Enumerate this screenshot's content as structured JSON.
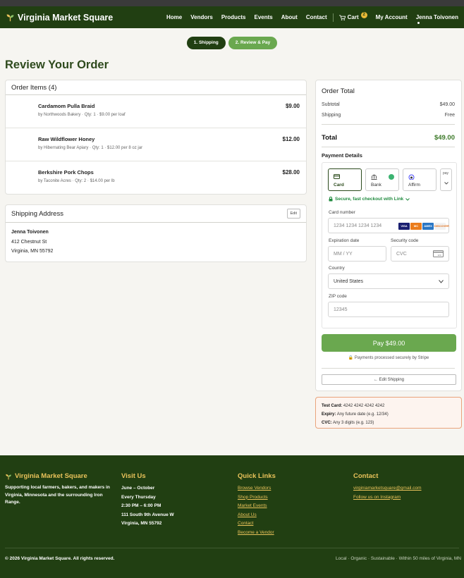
{
  "header": {
    "brand": "Virginia Market Square",
    "nav": [
      "Home",
      "Vendors",
      "Products",
      "Events",
      "About",
      "Contact"
    ],
    "cart_label": "Cart",
    "cart_count": "2",
    "account": "My Account",
    "user": "Jenna Toivonen"
  },
  "steps": [
    "1. Shipping",
    "2. Review & Pay"
  ],
  "page_title": "Review Your Order",
  "order_items": {
    "title": "Order Items (4)",
    "items": [
      {
        "name": "Cardamom Pulla Braid",
        "meta": "by Northwoods Bakery · Qty: 1 · $9.00 per loaf",
        "price": "$9.00"
      },
      {
        "name": "Raw Wildflower Honey",
        "meta": "by Hibernating Bear Apiary · Qty: 1 · $12.00 per 8 oz jar",
        "price": "$12.00"
      },
      {
        "name": "Berkshire Pork Chops",
        "meta": "by Taconite Acres · Qty: 2 · $14.00 per lb",
        "price": "$28.00"
      }
    ]
  },
  "shipping": {
    "title": "Shipping Address",
    "edit_label": "Edit",
    "name": "Jenna Toivonen",
    "street": "412 Chestnut St",
    "city": "Virginia, MN 55792"
  },
  "order_total": {
    "title": "Order Total",
    "subtotal_label": "Subtotal",
    "subtotal": "$49.00",
    "shipping_label": "Shipping",
    "shipping": "Free",
    "total_label": "Total",
    "total": "$49.00"
  },
  "payment": {
    "title": "Payment Details",
    "tabs": [
      "Card",
      "Bank",
      "Affirm",
      "pay"
    ],
    "secure_link": "Secure, fast checkout with Link",
    "card_number_label": "Card number",
    "card_number_placeholder": "1234 1234 1234 1234",
    "card_brands": [
      "VISA",
      "MC",
      "AMEX",
      "DISCOVER"
    ],
    "expiry_label": "Expiration date",
    "expiry_placeholder": "MM / YY",
    "cvc_label": "Security code",
    "cvc_placeholder": "CVC",
    "cvc_icon_text": "123",
    "country_label": "Country",
    "country_value": "United States",
    "zip_label": "ZIP code",
    "zip_placeholder": "12345",
    "pay_button": "Pay $49.00",
    "secure_note": "Payments processed securely by Stripe",
    "edit_shipping": "← Edit Shipping"
  },
  "test_info": {
    "card_label": "Test Card:",
    "card_value": "4242 4242 4242 4242",
    "expiry_label": "Expiry:",
    "expiry_value": "Any future date (e.g. 12/34)",
    "cvc_label": "CVC:",
    "cvc_value": "Any 3 digits (e.g. 123)"
  },
  "footer": {
    "brand": "Virginia Market Square",
    "about": "Supporting local farmers, bakers, and makers in Virginia, Minnesota and the surrounding Iron Range.",
    "visit_title": "Visit Us",
    "visit_lines": [
      "June – October",
      "Every Thursday",
      "2:30 PM – 6:00 PM",
      "111 South 9th Avenue W",
      "Virginia, MN 55792"
    ],
    "quick_title": "Quick Links",
    "quick_links": [
      "Browse Vendors",
      "Shop Products",
      "Market Events",
      "About Us",
      "Contact",
      "Become a Vendor"
    ],
    "contact_title": "Contact",
    "email": "virginiamarketsquare@gmail.com",
    "instagram": "Follow us on Instagram",
    "copyright": "© 2026 Virginia Market Square. All rights reserved.",
    "tagline": "Local · Organic · Sustainable · Within 50 miles of Virginia, MN"
  },
  "colors": {
    "primary_dark": "#213f12",
    "accent_green": "#6aa84f",
    "footer_heading": "#e9c25a",
    "total_green": "#3d7a2a"
  }
}
